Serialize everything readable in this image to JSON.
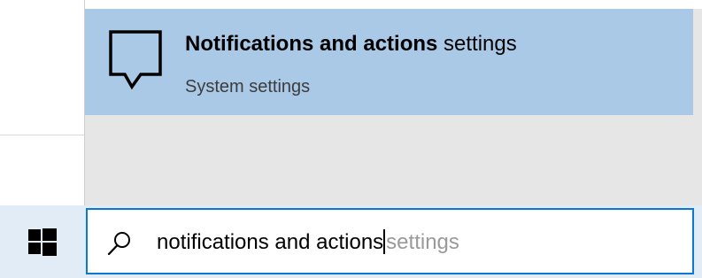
{
  "search_results": {
    "top_result": {
      "icon": "notification-bubble-icon",
      "title_bold": "Notifications and actions",
      "title_rest": " settings",
      "subtitle": "System settings"
    }
  },
  "taskbar": {
    "start_icon": "windows-logo-icon",
    "search": {
      "icon": "search-icon",
      "typed_text": "notifications and actions",
      "autocomplete_suffix": "settings"
    }
  },
  "colors": {
    "highlight": "#a9c9e6",
    "panel_bg": "#e6e6e6",
    "taskbar_bg": "#e2ecf6",
    "search_border": "#0a78d4"
  }
}
